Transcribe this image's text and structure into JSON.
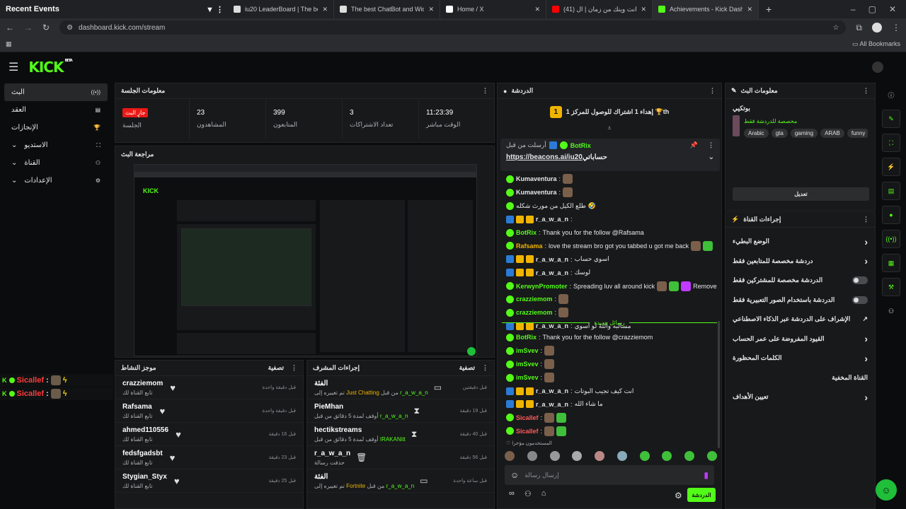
{
  "browser": {
    "recent_events": "Recent Events",
    "tabs": [
      {
        "title": "iu20 LeaderBoard | The best Cha...",
        "color": "#dddddd"
      },
      {
        "title": "The best ChatBot and Widgets ...",
        "color": "#dddddd"
      },
      {
        "title": "Home / X",
        "color": "#ffffff"
      },
      {
        "title": "(41) حبيبي انت وينك من زمان | ال...",
        "color": "#ff0000"
      },
      {
        "title": "Achievements - Kick Dashboard",
        "color": "#53fc18"
      }
    ],
    "url": "dashboard.kick.com/stream",
    "all_bookmarks": "All Bookmarks"
  },
  "app": {
    "logo": "KICK",
    "logo_sup": "BETA",
    "accent": "#53fc18"
  },
  "sidebar": {
    "items": [
      {
        "label": "البث",
        "icon": "broadcast-icon",
        "glyph": "((•))"
      },
      {
        "label": "العقد",
        "icon": "contract-icon",
        "glyph": "▤"
      },
      {
        "label": "الإنجازات",
        "icon": "trophy-icon",
        "glyph": "🏆"
      },
      {
        "label": "الاستديو",
        "icon": "studio-icon",
        "glyph": "⛶"
      },
      {
        "label": "القناة",
        "icon": "channel-icon",
        "glyph": "⚇"
      },
      {
        "label": "الإعدادات",
        "icon": "gear-icon",
        "glyph": "⚙"
      }
    ]
  },
  "overlay_alerts": [
    {
      "name": "Sicallef",
      "sep": ":"
    },
    {
      "name": "Sicallef",
      "sep": ":"
    }
  ],
  "session": {
    "title": "معلومات الجلسة",
    "live_label": "جارٍ البث",
    "session_label": "الجلسة",
    "stats": [
      {
        "value": "23",
        "label": "المشاهدون"
      },
      {
        "value": "399",
        "label": "المتابعون"
      },
      {
        "value": "3",
        "label": "تعداد الاشتراكات"
      },
      {
        "value": "11:23:39",
        "label": "الوقت مباشر"
      }
    ]
  },
  "preview": {
    "title": "مراجعة البث"
  },
  "activity": {
    "title": "موجز النشاط",
    "filter": "تصفية",
    "items": [
      {
        "name": "crazziemom",
        "sub": "تابع القناة لك",
        "time": "قبل دقيقة واحدة"
      },
      {
        "name": "Rafsama",
        "sub": "تابع القناة لك",
        "time": "قبل دقيقة واحدة"
      },
      {
        "name": "ahmed110556",
        "sub": "تابع القناة لك",
        "time": "قبل 16 دقيقة"
      },
      {
        "name": "fedsfgadsbt",
        "sub": "تابع القناة لك",
        "time": "قبل 23 دقيقة"
      },
      {
        "name": "Stygian_Styx",
        "sub": "تابع القناة لك",
        "time": "قبل 25 دقيقة"
      }
    ]
  },
  "modactions": {
    "title": "إجراءات المشرف",
    "filter": "تصفية",
    "items": [
      {
        "icon": "category-icon",
        "glyph": "▭",
        "name": "الفئة",
        "sub_a": "تم تغييره إلى ",
        "sub_hl": "Just Chatting",
        "sub_b": " من قبل ",
        "sub_user": "r_a_w_a_n",
        "time": "قبل دقيقتين"
      },
      {
        "icon": "timeout-icon",
        "glyph": "⧗",
        "name": "PieMhan",
        "sub_a": "أوقف لمدة 5 دقائق من قبل ",
        "sub_hl": "",
        "sub_b": "",
        "sub_user": "r_a_w_a_n",
        "time": "قبل 19 دقيقة"
      },
      {
        "icon": "timeout-icon",
        "glyph": "⧗",
        "name": "hectikstreams",
        "sub_a": "أوقف لمدة 5 دقائق من قبل ",
        "sub_hl": "",
        "sub_b": "",
        "sub_user": "IRAKANitt",
        "time": "قبل 40 دقيقة"
      },
      {
        "icon": "delete-icon",
        "glyph": "🗑",
        "name": "r_a_w_a_n",
        "sub_a": "حذفت رسالة",
        "sub_hl": "",
        "sub_b": "",
        "sub_user": "",
        "time": "قبل 56 دقيقة"
      },
      {
        "icon": "category-icon",
        "glyph": "▭",
        "name": "الفئة",
        "sub_a": "تم تغييره إلى ",
        "sub_hl": "Fortnite",
        "sub_b": " من قبل ",
        "sub_user": "r_a_w_a_n",
        "time": "قبل ساعة واحدة"
      }
    ]
  },
  "chat": {
    "title": "الدردشة",
    "goal": "إهداء 1 اشتراك للوصول للمركز 1 🏆th",
    "goal_rank": "1",
    "pinned": {
      "by": "أرسلت من قبل",
      "user": "BotRix",
      "link": "https://beacons.ai/iu20",
      "suffix": " حساباتي"
    },
    "new_messages": "رسائل جديدة",
    "messages": [
      {
        "user": "Kumaventura",
        "color": "#e6e7e8",
        "badges": [
          "grn"
        ],
        "text": "",
        "emotes": 1
      },
      {
        "user": "Kumaventura",
        "color": "#e6e7e8",
        "badges": [
          "grn"
        ],
        "text": "",
        "emotes": 1
      },
      {
        "user": "",
        "color": "#e6e7e8",
        "badges": [
          "grn"
        ],
        "text": "طلع الكيل من مورث شكله 🤣",
        "emotes": 0
      },
      {
        "user": "r_a_w_a_n",
        "color": "#e6e7e8",
        "badges": [
          "blue",
          "gold",
          "gold"
        ],
        "text": "",
        "emotes": 0
      },
      {
        "user": "BotRix",
        "color": "#53fc18",
        "badges": [
          "grn"
        ],
        "text": "Thank you for the follow @Rafsama",
        "emotes": 0
      },
      {
        "user": "Rafsama",
        "color": "#f0b400",
        "badges": [
          "grn"
        ],
        "text": "love the stream bro got you tabbed u got me back",
        "emotes": 2
      },
      {
        "user": "r_a_w_a_n",
        "color": "#e6e7e8",
        "badges": [
          "blue",
          "gold",
          "gold"
        ],
        "text": "اسوي حساب",
        "emotes": 0
      },
      {
        "user": "r_a_w_a_n",
        "color": "#e6e7e8",
        "badges": [
          "blue",
          "gold",
          "gold"
        ],
        "text": "لوسك",
        "emotes": 0
      },
      {
        "user": "KerwynPromoter",
        "color": "#53fc18",
        "badges": [
          "grn"
        ],
        "text": "Spreading luv all around kick",
        "emotes": 3,
        "tail": "Remove"
      },
      {
        "user": "crazziemom",
        "color": "#53fc18",
        "badges": [
          "grn"
        ],
        "text": "",
        "emotes": 1
      },
      {
        "user": "crazziemom",
        "color": "#53fc18",
        "badges": [
          "grn"
        ],
        "text": "",
        "emotes": 1
      },
      {
        "user": "r_a_w_a_n",
        "color": "#e6e7e8",
        "badges": [
          "blue",
          "gold",
          "gold"
        ],
        "text": "مسالبه واللهّ لو اسوي",
        "emotes": 0
      }
    ],
    "messages2": [
      {
        "user": "BotRix",
        "color": "#53fc18",
        "badges": [
          "grn"
        ],
        "text": "Thank you for the follow @crazziemom",
        "emotes": 0
      },
      {
        "user": "imSvev",
        "color": "#53fc18",
        "badges": [
          "grn"
        ],
        "text": "",
        "emotes": 1
      },
      {
        "user": "imSvev",
        "color": "#53fc18",
        "badges": [
          "grn"
        ],
        "text": "",
        "emotes": 1
      },
      {
        "user": "imSvev",
        "color": "#53fc18",
        "badges": [
          "grn"
        ],
        "text": "",
        "emotes": 1
      },
      {
        "user": "r_a_w_a_n",
        "color": "#e6e7e8",
        "badges": [
          "blue",
          "gold",
          "gold"
        ],
        "text": "انت كيف تجيب البوتات",
        "emotes": 0
      },
      {
        "user": "r_a_w_a_n",
        "color": "#e6e7e8",
        "badges": [
          "blue",
          "gold",
          "gold"
        ],
        "text": "ما شاء الله",
        "emotes": 0
      },
      {
        "user": "Sicallef",
        "color": "#ff5a5a",
        "badges": [
          "grn"
        ],
        "text": "",
        "emotes": 2
      },
      {
        "user": "Sicallef",
        "color": "#ff5a5a",
        "badges": [
          "grn"
        ],
        "text": "",
        "emotes": 2
      }
    ],
    "recent_emotes_label": "المستخدمون مؤخرا",
    "input_placeholder": "إرسال رسالة",
    "send_label": "الدردشة"
  },
  "stream_info": {
    "title": "معلومات البث",
    "stream_title": "بوتكيي",
    "subtitle": "مخصصة للدردشة فقط",
    "tags": [
      "Arabic",
      "gta",
      "gaming",
      "ARAB",
      "funny"
    ],
    "edit_label": "تعديل"
  },
  "channel_actions": {
    "title": "إجراءات القناة",
    "items": [
      {
        "label": "الوضع البطيء",
        "control": "chevron"
      },
      {
        "label": "دردشة مخصصة للمتابعين فقط",
        "control": "chevron"
      },
      {
        "label": "الدردشة مخصصة للمشتركين فقط",
        "control": "toggle"
      },
      {
        "label": "الدردشة باستخدام الصور التعبيرية فقط",
        "control": "toggle"
      },
      {
        "label": "الإشراف على الدردشة عبر الذكاء الاصطناعي",
        "control": "external"
      },
      {
        "label": "القيود المفروضة على عمر الحساب",
        "control": "chevron"
      },
      {
        "label": "الكلمات المحظورة",
        "control": "chevron"
      },
      {
        "label": "القناة المخفية",
        "control": "none"
      },
      {
        "label": "تعيين الأهداف",
        "control": "chevron"
      }
    ]
  },
  "right_rail": [
    "info-icon",
    "pencil-icon",
    "screen-icon",
    "bolt-icon",
    "note-icon",
    "chat-icon",
    "broadcast-icon",
    "layout-icon",
    "wrench-icon",
    "people-icon"
  ]
}
